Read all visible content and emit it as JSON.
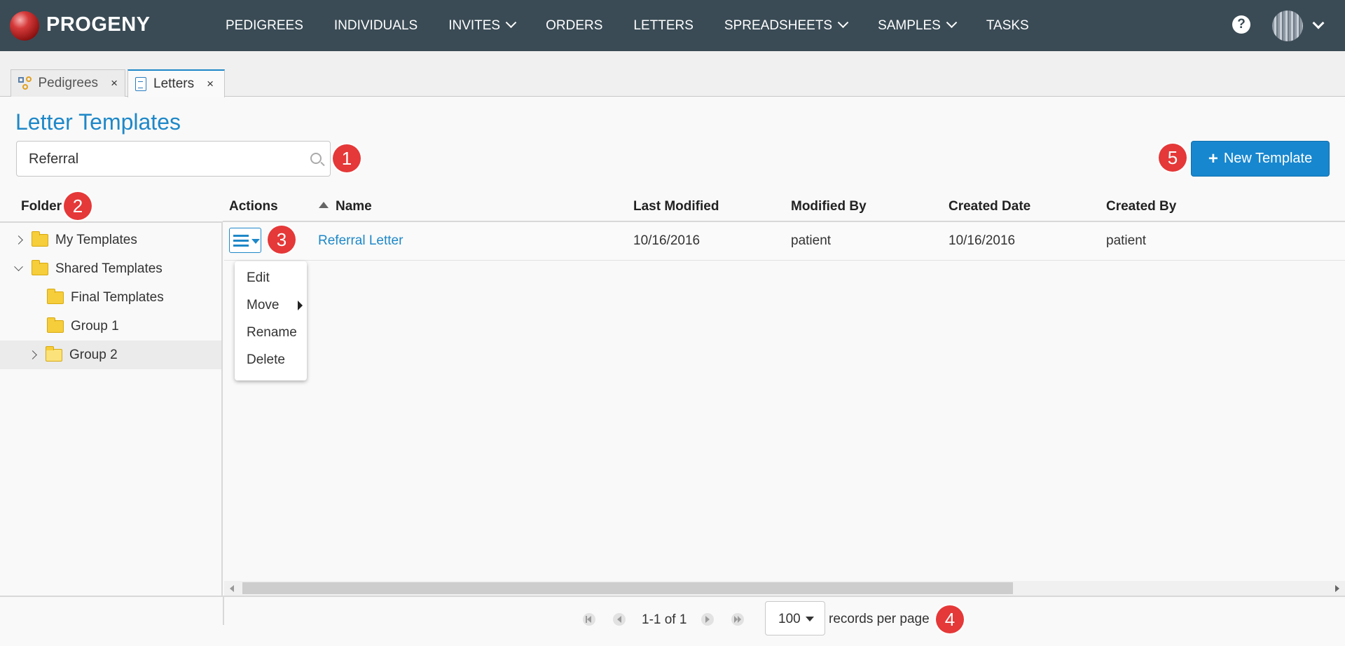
{
  "app": {
    "brand": "PROGENY",
    "nav": [
      {
        "label": "PEDIGREES",
        "dropdown": false
      },
      {
        "label": "INDIVIDUALS",
        "dropdown": false
      },
      {
        "label": "INVITES",
        "dropdown": true
      },
      {
        "label": "ORDERS",
        "dropdown": false
      },
      {
        "label": "LETTERS",
        "dropdown": false
      },
      {
        "label": "SPREADSHEETS",
        "dropdown": true
      },
      {
        "label": "SAMPLES",
        "dropdown": true
      },
      {
        "label": "TASKS",
        "dropdown": false
      }
    ],
    "help_glyph": "?"
  },
  "tabs": [
    {
      "label": "Pedigrees",
      "close": "×",
      "icon": "pedigree-icon",
      "active": false
    },
    {
      "label": "Letters",
      "close": "×",
      "icon": "document-icon",
      "active": true
    }
  ],
  "page": {
    "title": "Letter Templates",
    "search_value": "Referral",
    "new_button": {
      "plus": "+",
      "label": "New Template"
    }
  },
  "badges": [
    "1",
    "2",
    "3",
    "4",
    "5"
  ],
  "folders": {
    "header": "Folder",
    "items": [
      {
        "label": "My Templates",
        "expand": "collapsed"
      },
      {
        "label": "Shared Templates",
        "expand": "expanded"
      },
      {
        "label": "Final Templates",
        "expand": "none"
      },
      {
        "label": "Group 1",
        "expand": "none"
      },
      {
        "label": "Group 2",
        "expand": "collapsed",
        "selected": true
      }
    ]
  },
  "grid": {
    "columns": [
      "Actions",
      "Name",
      "Last Modified",
      "Modified By",
      "Created Date",
      "Created By"
    ],
    "rows": [
      {
        "name": "Referral Letter",
        "last_modified": "10/16/2016",
        "modified_by": "patient",
        "created_date": "10/16/2016",
        "created_by": "patient"
      }
    ]
  },
  "action_menu": [
    "Edit",
    "Move",
    "Rename",
    "Delete"
  ],
  "pager": {
    "summary": "1-1 of 1",
    "page_size": "100",
    "records_label": "records per page"
  },
  "colors": {
    "topbar": "#3a4b55",
    "accent": "#1e88c8",
    "badge": "#e53838",
    "folder": "#f6cd3a"
  }
}
